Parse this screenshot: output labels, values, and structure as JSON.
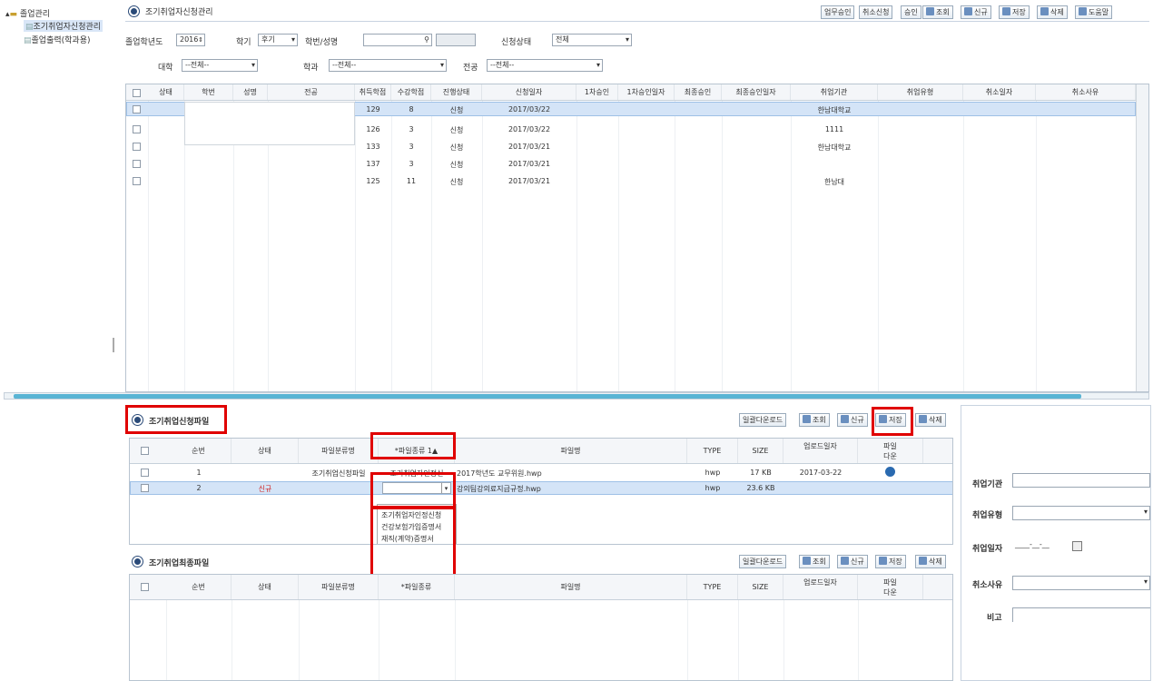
{
  "tree": {
    "root": "졸업관리",
    "items": [
      "조기취업자신청관리",
      "졸업출력(학과용)"
    ]
  },
  "title": "조기취업자신청관리",
  "toolbar": [
    "업무승인",
    "취소신청",
    "승인",
    "조회",
    "신규",
    "저장",
    "삭제",
    "도움말"
  ],
  "filters": {
    "grad_year_label": "졸업학년도",
    "grad_year_value": "2016",
    "semester_label": "학기",
    "semester_value": "후기",
    "student_label": "학번/성명",
    "student_value": "",
    "status_label": "신청상태",
    "status_value": "전체",
    "college_label": "대학",
    "college_value": "--전체--",
    "dept_label": "학과",
    "dept_value": "--전체--",
    "major_label": "전공",
    "major_value": "--전체--"
  },
  "main_grid": {
    "headers": [
      "상태",
      "학번",
      "성명",
      "전공",
      "취득학점",
      "수강학점",
      "진행상태",
      "신청일자",
      "1차승인",
      "1차승인일자",
      "최종승인",
      "최종승인일자",
      "취업기관",
      "취업유형",
      "취소일자",
      "취소사유"
    ],
    "rows": [
      {
        "credits": "129",
        "taking": "8",
        "state": "신청",
        "date": "2017/03/22",
        "org": "한남대학교"
      },
      {
        "credits": "126",
        "taking": "3",
        "state": "신청",
        "date": "2017/03/22",
        "org": "1111"
      },
      {
        "credits": "133",
        "taking": "3",
        "state": "신청",
        "date": "2017/03/21",
        "org": "한남대학교"
      },
      {
        "credits": "137",
        "taking": "3",
        "state": "신청",
        "date": "2017/03/21",
        "org": ""
      },
      {
        "credits": "125",
        "taking": "11",
        "state": "신청",
        "date": "2017/03/21",
        "org": "한남대"
      }
    ]
  },
  "apply_files": {
    "title": "조기취업신청파일",
    "buttons": [
      "일괄다운로드",
      "조회",
      "신규",
      "저장",
      "삭제"
    ],
    "headers": [
      "순번",
      "상태",
      "파일분류명",
      "*파일종류",
      "파일명",
      "TYPE",
      "SIZE",
      "업로드일자",
      "파일다운"
    ],
    "sort_mark": "1▲",
    "rows": [
      {
        "no": "1",
        "status": "",
        "category": "조기취업신청파일",
        "kind": "조기취업자인정신",
        "file": "2017학년도 교무위원.hwp",
        "type": "hwp",
        "size": "17 KB",
        "date": "2017-03-22"
      },
      {
        "no": "2",
        "status": "신규",
        "category": "",
        "kind": "",
        "file": "강의팀강의료지급규정.hwp",
        "type": "hwp",
        "size": "23.6 KB",
        "date": ""
      }
    ],
    "dropdown_options": [
      "조기취업자인정신청",
      "건강보험가입증명서",
      "재직(계약)증명서"
    ]
  },
  "final_files": {
    "title": "조기취업최종파일",
    "buttons": [
      "일괄다운로드",
      "조회",
      "신규",
      "저장",
      "삭제"
    ],
    "headers": [
      "순번",
      "상태",
      "파일분류명",
      "*파일종류",
      "파일명",
      "TYPE",
      "SIZE",
      "업로드일자",
      "파일다운"
    ]
  },
  "side_form": {
    "org_label": "취업기관",
    "org_value": "",
    "type_label": "취업유형",
    "type_value": "",
    "date_label": "취업일자",
    "date_value": "____-__-__",
    "cancel_label": "취소사유",
    "cancel_value": "",
    "note_label": "비고",
    "note_value": ""
  }
}
